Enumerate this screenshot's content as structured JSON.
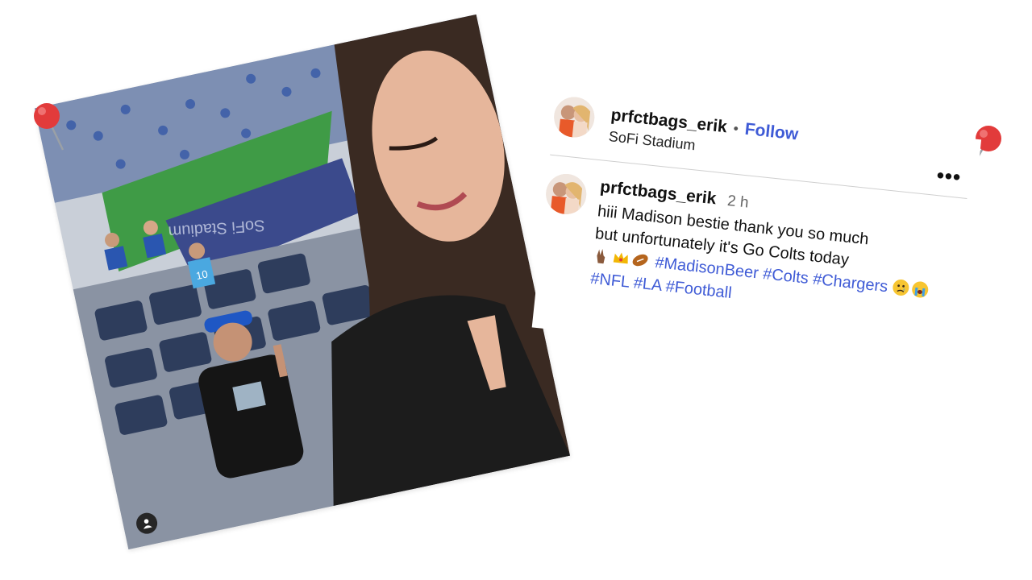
{
  "post": {
    "username": "prfctbags_erik",
    "separator": "•",
    "follow_label": "Follow",
    "location": "SoFi Stadium",
    "more_label": "•••"
  },
  "caption": {
    "username": "prfctbags_erik",
    "timestamp": "2 h",
    "line1": "hiii Madison bestie thank you so much",
    "line2": "but unfortunately it's Go Colts today",
    "hashtags": [
      "#MadisonBeer",
      "#Colts",
      "#Chargers",
      "#NFL",
      "#LA",
      "#Football"
    ]
  },
  "photo": {
    "stadium_sign": "SoFi Stadium",
    "jersey_number": "10"
  },
  "colors": {
    "link_blue": "#3f5bd6",
    "pin_red": "#e23b3b",
    "divider": "#cfcfcf"
  },
  "icons": {
    "pin_left": "pushpin-icon",
    "pin_right": "pushpin-icon",
    "user_tag": "user-tag-icon",
    "more": "more-options-icon"
  }
}
